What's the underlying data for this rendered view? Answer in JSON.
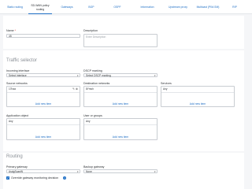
{
  "tabs": [
    {
      "label": "Static routing",
      "active": false
    },
    {
      "label": "SD-WAN policy routing",
      "active": true
    },
    {
      "label": "Gateways",
      "active": false
    },
    {
      "label": "BGP",
      "active": false
    },
    {
      "label": "OSPF",
      "active": false
    },
    {
      "label": "Information",
      "active": false
    },
    {
      "label": "Upstream proxy",
      "active": false
    },
    {
      "label": "Multicast (PIM-SM)",
      "active": false
    },
    {
      "label": "RIP",
      "active": false
    }
  ],
  "general": {
    "name_label": "Name",
    "name_required": "*",
    "name_value": "45",
    "description_label": "Description",
    "description_placeholder": "Enter Description"
  },
  "traffic_selector": {
    "title": "Traffic selector",
    "incoming_interface_label": "Incoming interface",
    "incoming_interface_value": "Select interface",
    "dscp_label": "DSCP marking",
    "dscp_value": "Select DSCP marking",
    "source_networks_label": "Source networks",
    "source_networks_item": "17haa",
    "source_networks_add": "Add new item",
    "destination_networks_label": "Destination networks",
    "destination_networks_item": "8Ymch",
    "destination_networks_add": "Add new item",
    "services_label": "Services",
    "services_item": "Any",
    "services_add": "Add new item",
    "application_object_label": "Application object",
    "application_object_item": "Any",
    "application_object_add": "Add new item",
    "users_label": "User or groups",
    "users_item": "Any",
    "users_add": "Add new item"
  },
  "routing": {
    "title": "Routing",
    "primary_gateway_label": "Primary gateway",
    "primary_gateway_value": "AsdgScaeW",
    "backup_gateway_label": "Backup gateway",
    "backup_gateway_value": "None",
    "override_label": "Override gateway monitoring decision",
    "override_checked": true
  }
}
